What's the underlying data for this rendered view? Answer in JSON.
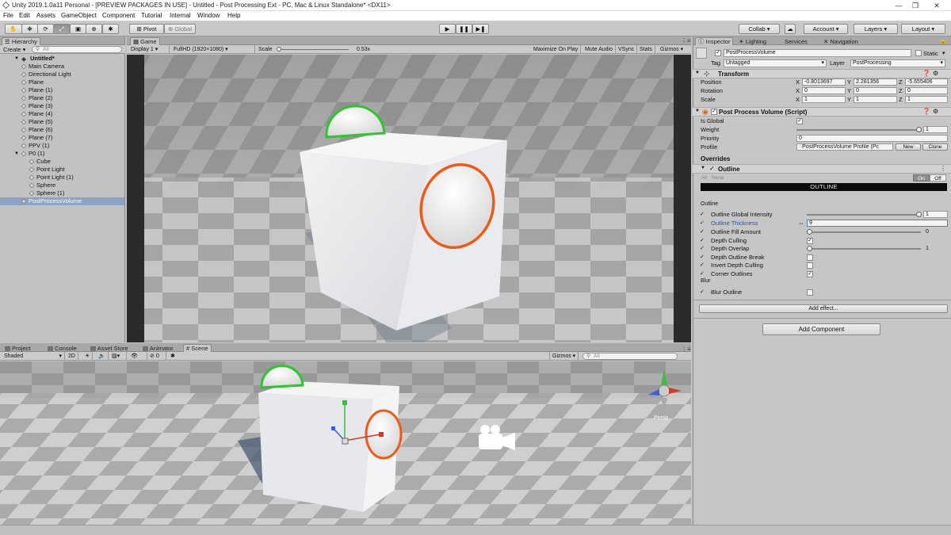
{
  "window": {
    "title": "Unity 2019.1.0a11 Personal - [PREVIEW PACKAGES IN USE] - Untitled - Post Processing Ext - PC, Mac & Linux Standalone* <DX11>"
  },
  "menu": [
    "File",
    "Edit",
    "Assets",
    "GameObject",
    "Component",
    "Tutorial",
    "Internal",
    "Window",
    "Help"
  ],
  "toolbar": {
    "pivot": "Pivot",
    "global": "Global",
    "collab": "Collab ▾",
    "account": "Account",
    "layers": "Layers",
    "layout": "Layout"
  },
  "hierarchy": {
    "tab": "Hierarchy",
    "create": "Create ▾",
    "search_placeholder": "All",
    "scene": "Untitled*",
    "items": [
      "Main Camera",
      "Directional Light",
      "Plane",
      "Plane (1)",
      "Plane (2)",
      "Plane (3)",
      "Plane (4)",
      "Plane (5)",
      "Plane (6)",
      "Plane (7)",
      "PPV (1)",
      "P0 (1)",
      "Cube",
      "Point Light",
      "Point Light (1)",
      "Sphere",
      "Sphere (1)",
      "PostProcessVolume"
    ]
  },
  "game": {
    "tab": "Game",
    "display": "Display 1",
    "resolution": "FullHD (1920×1080)",
    "scale_label": "Scale",
    "scale_value": "0.53x",
    "buttons": [
      "Maximize On Play",
      "Mute Audio",
      "VSync",
      "Stats",
      "Gizmos ▾"
    ]
  },
  "bottom_tabs": [
    "Project",
    "Console",
    "Asset Store",
    "Animator",
    "Scene"
  ],
  "scene_view": {
    "shading": "Shaded",
    "mode2d": "2D",
    "gizmos": "Gizmos ▾",
    "search_placeholder": "All",
    "layer_count": "0",
    "persp": "Persp"
  },
  "inspector": {
    "tabs": [
      "Inspector",
      "Lighting",
      "Services",
      "Navigation"
    ],
    "object_name": "PostProcessVolume",
    "static": "Static",
    "tag_label": "Tag",
    "tag": "Untagged",
    "layer_label": "Layer",
    "layer": "PostProcessing",
    "transform": {
      "title": "Transform",
      "position": {
        "label": "Position",
        "x": "-0.8013697",
        "y": "2.281356",
        "z": "-5.655406"
      },
      "rotation": {
        "label": "Rotation",
        "x": "0",
        "y": "0",
        "z": "0"
      },
      "scale": {
        "label": "Scale",
        "x": "1",
        "y": "1",
        "z": "1"
      }
    },
    "ppv": {
      "title": "Post Process Volume (Script)",
      "is_global": "Is Global",
      "weight_label": "Weight",
      "weight": "1",
      "priority_label": "Priority",
      "priority": "0",
      "profile_label": "Profile",
      "profile": "PostProcessVolume Profile (Pc",
      "new": "New",
      "clone": "Clone"
    },
    "overrides": "Overrides",
    "outline": {
      "title": "Outline",
      "all": "All",
      "none": "None",
      "on": "On",
      "off": "Off",
      "banner": "OUTLINE",
      "section": "Outline",
      "global_intensity": {
        "label": "Outline Global Intensity",
        "value": "1",
        "fraction": 1.0
      },
      "thickness": {
        "label": "Outline Thickness",
        "value": "9"
      },
      "fill_amount": {
        "label": "Outline Fill Amount",
        "value": "0",
        "fraction": 0.0
      },
      "depth_culling": "Depth Culling",
      "depth_overlap": {
        "label": "Depth Overlap",
        "value": "1",
        "fraction": 0.0
      },
      "depth_outline_break": "Depth Outline Break",
      "invert_depth_culling": "Invert Depth Culling",
      "corner_outlines": "Corner Outlines",
      "blur_section": "Blur",
      "blur_outline": "Blur Outline"
    },
    "add_effect": "Add effect...",
    "add_component": "Add Component"
  },
  "colors": {
    "selection": "#8ea2c4",
    "outline_green": "#2ec52e",
    "outline_orange": "#ee5a18",
    "link_blue": "#2a52be"
  }
}
